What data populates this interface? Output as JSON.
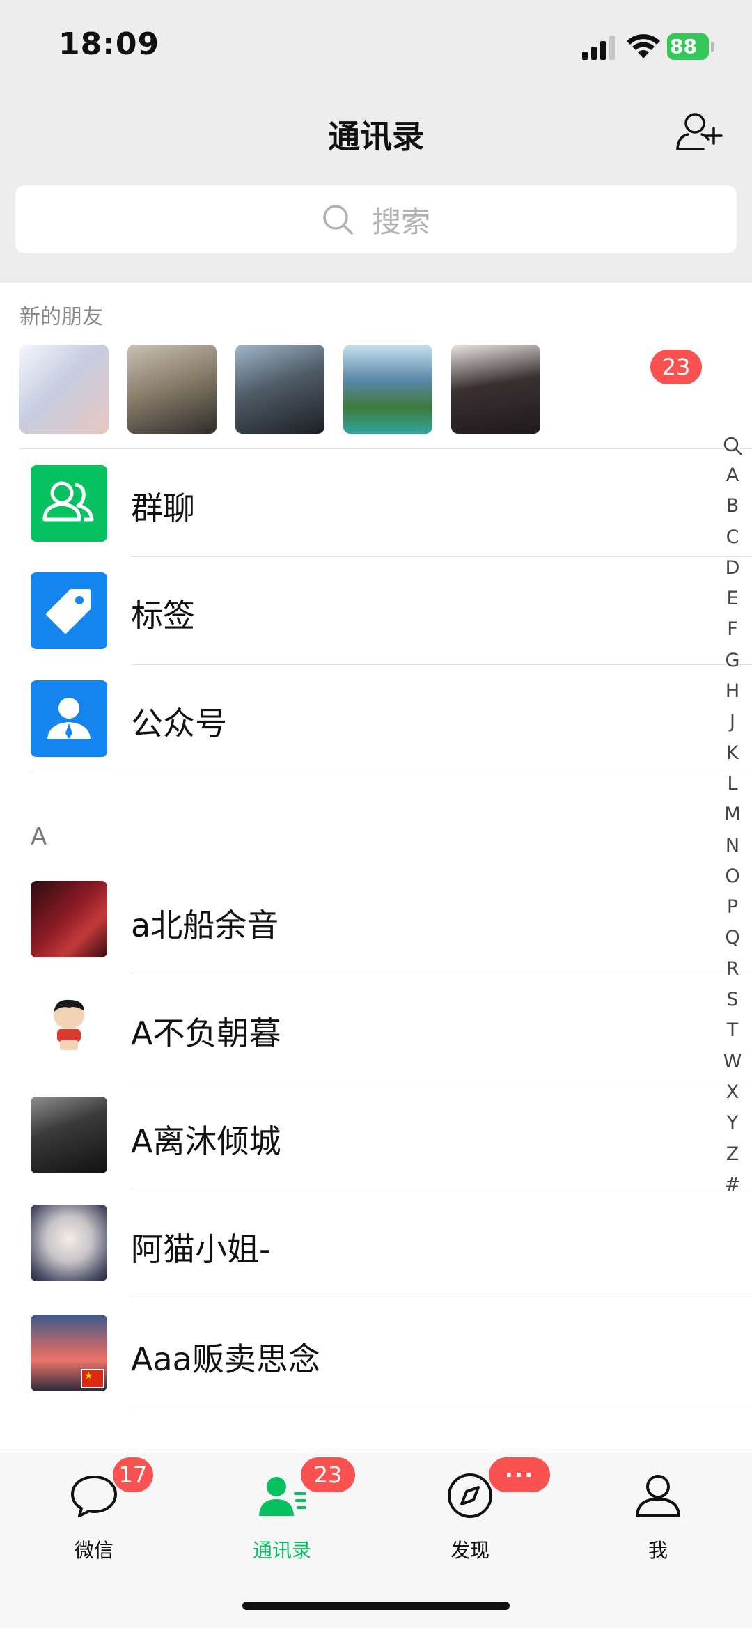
{
  "status": {
    "time": "18:09",
    "battery": "88"
  },
  "header": {
    "title": "通讯录"
  },
  "search": {
    "placeholder": "搜索"
  },
  "new_friends": {
    "label": "新的朋友",
    "badge": "23"
  },
  "functions": [
    {
      "label": "群聊",
      "icon": "group-chat-icon",
      "color": "#07c160"
    },
    {
      "label": "标签",
      "icon": "tag-icon",
      "color": "#1485ee"
    },
    {
      "label": "公众号",
      "icon": "official-account-icon",
      "color": "#1485ee"
    }
  ],
  "section": "A",
  "contacts": [
    {
      "name": "a北船余音"
    },
    {
      "name": "A不负朝暮"
    },
    {
      "name": "A离沐倾城"
    },
    {
      "name": "阿猫小姐-"
    },
    {
      "name": "Aaa贩卖思念"
    }
  ],
  "index_bar": [
    "A",
    "B",
    "C",
    "D",
    "E",
    "F",
    "G",
    "H",
    "J",
    "K",
    "L",
    "M",
    "N",
    "O",
    "P",
    "Q",
    "R",
    "S",
    "T",
    "W",
    "X",
    "Y",
    "Z",
    "#"
  ],
  "tabs": [
    {
      "label": "微信",
      "badge": "17",
      "icon": "chat-bubble-icon"
    },
    {
      "label": "通讯录",
      "badge": "23",
      "icon": "contacts-icon",
      "active": true
    },
    {
      "label": "发现",
      "badge": "···",
      "icon": "compass-icon"
    },
    {
      "label": "我",
      "icon": "person-icon"
    }
  ],
  "colors": {
    "accent": "#07c160",
    "badge": "#fa5151",
    "blue": "#1485ee"
  }
}
